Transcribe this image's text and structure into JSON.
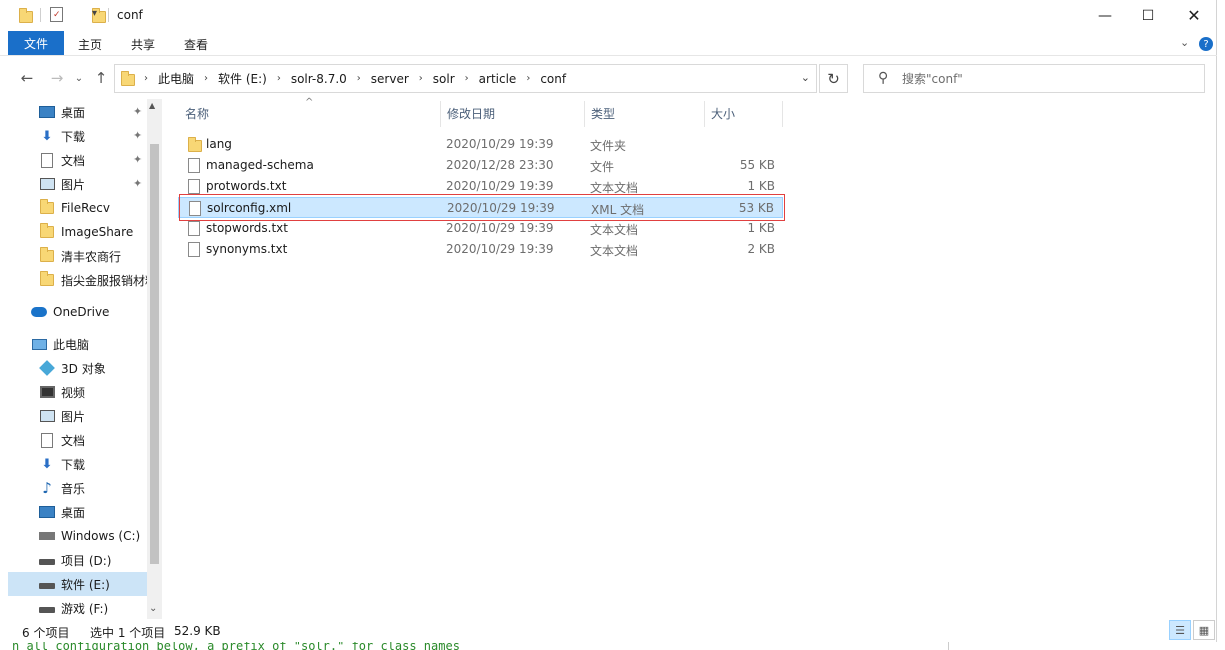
{
  "window": {
    "title": "conf"
  },
  "ribbon": {
    "tabs": [
      "文件",
      "主页",
      "共享",
      "查看"
    ]
  },
  "address": {
    "crumbs": [
      "此电脑",
      "软件 (E:)",
      "solr-8.7.0",
      "server",
      "solr",
      "article",
      "conf"
    ]
  },
  "search": {
    "placeholder": "搜索\"conf\""
  },
  "nav": {
    "quick_access": [
      {
        "label": "桌面",
        "icon": "desktop-icon",
        "pinned": true
      },
      {
        "label": "下载",
        "icon": "download-icon",
        "pinned": true
      },
      {
        "label": "文档",
        "icon": "document-icon",
        "pinned": true
      },
      {
        "label": "图片",
        "icon": "picture-icon",
        "pinned": true
      },
      {
        "label": "FileRecv",
        "icon": "folder-icon",
        "pinned": false
      },
      {
        "label": "ImageShare",
        "icon": "folder-icon",
        "pinned": false
      },
      {
        "label": "清丰农商行",
        "icon": "folder-icon",
        "pinned": false
      },
      {
        "label": "指尖金服报销材料",
        "icon": "folder-icon",
        "pinned": false
      }
    ],
    "onedrive": "OneDrive",
    "this_pc": "此电脑",
    "pc_items": [
      {
        "label": "3D 对象",
        "icon": "3d-objects-icon"
      },
      {
        "label": "视频",
        "icon": "video-icon"
      },
      {
        "label": "图片",
        "icon": "picture-icon"
      },
      {
        "label": "文档",
        "icon": "document-icon"
      },
      {
        "label": "下载",
        "icon": "download-icon"
      },
      {
        "label": "音乐",
        "icon": "music-icon"
      },
      {
        "label": "桌面",
        "icon": "desktop-icon"
      },
      {
        "label": "Windows (C:)",
        "icon": "windows-drive-icon"
      },
      {
        "label": "项目 (D:)",
        "icon": "drive-icon"
      },
      {
        "label": "软件 (E:)",
        "icon": "drive-icon",
        "selected": true
      },
      {
        "label": "游戏 (F:)",
        "icon": "drive-icon"
      }
    ]
  },
  "columns": {
    "name": "名称",
    "date": "修改日期",
    "type": "类型",
    "size": "大小"
  },
  "files": [
    {
      "name": "lang",
      "date": "2020/10/29 19:39",
      "type": "文件夹",
      "size": "",
      "kind": "folder"
    },
    {
      "name": "managed-schema",
      "date": "2020/12/28 23:30",
      "type": "文件",
      "size": "55 KB",
      "kind": "file"
    },
    {
      "name": "protwords.txt",
      "date": "2020/10/29 19:39",
      "type": "文本文档",
      "size": "1 KB",
      "kind": "file"
    },
    {
      "name": "solrconfig.xml",
      "date": "2020/10/29 19:39",
      "type": "XML 文档",
      "size": "53 KB",
      "kind": "file",
      "selected": true
    },
    {
      "name": "stopwords.txt",
      "date": "2020/10/29 19:39",
      "type": "文本文档",
      "size": "1 KB",
      "kind": "file"
    },
    {
      "name": "synonyms.txt",
      "date": "2020/10/29 19:39",
      "type": "文本文档",
      "size": "2 KB",
      "kind": "file"
    }
  ],
  "status": {
    "count": "6 个项目",
    "selected": "选中 1 个项目",
    "size": "52.9 KB"
  },
  "background_text": "n all configuration below, a prefix of \"solr.\" for class names"
}
